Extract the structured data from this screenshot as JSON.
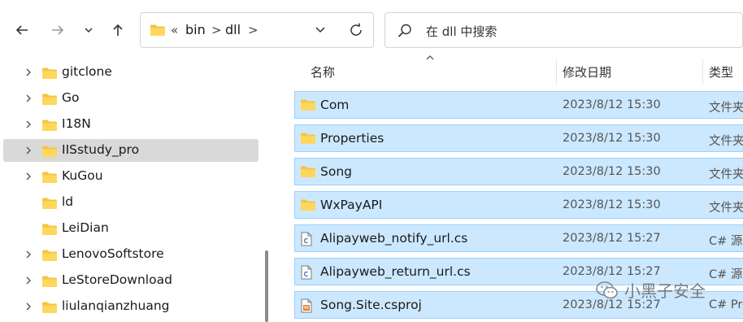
{
  "nav": {
    "back_icon": "arrow-left-icon",
    "forward_icon": "arrow-right-icon",
    "recent_icon": "chevron-down-icon",
    "up_icon": "arrow-up-icon"
  },
  "address": {
    "overflow": "«",
    "crumbs": [
      "bin",
      "dll"
    ],
    "separator": ">",
    "refresh_icon": "refresh-icon"
  },
  "search": {
    "placeholder": "在 dll 中搜索",
    "icon": "search-icon"
  },
  "sidebar": {
    "items": [
      {
        "label": "gitclone",
        "has_children": true,
        "selected": false
      },
      {
        "label": "Go",
        "has_children": true,
        "selected": false
      },
      {
        "label": "I18N",
        "has_children": true,
        "selected": false
      },
      {
        "label": "IISstudy_pro",
        "has_children": true,
        "selected": true
      },
      {
        "label": "KuGou",
        "has_children": true,
        "selected": false
      },
      {
        "label": "ld",
        "has_children": false,
        "selected": false
      },
      {
        "label": "LeiDian",
        "has_children": false,
        "selected": false
      },
      {
        "label": "LenovoSoftstore",
        "has_children": true,
        "selected": false
      },
      {
        "label": "LeStoreDownload",
        "has_children": true,
        "selected": false
      },
      {
        "label": "liulanqianzhuang",
        "has_children": true,
        "selected": false
      }
    ]
  },
  "columns": {
    "name": "名称",
    "modified": "修改日期",
    "type": "类型"
  },
  "files": [
    {
      "name": "Com",
      "date": "2023/8/12 15:30",
      "type": "文件夹",
      "icon": "folder-icon"
    },
    {
      "name": "Properties",
      "date": "2023/8/12 15:30",
      "type": "文件夹",
      "icon": "folder-icon"
    },
    {
      "name": "Song",
      "date": "2023/8/12 15:30",
      "type": "文件夹",
      "icon": "folder-icon"
    },
    {
      "name": "WxPayAPI",
      "date": "2023/8/12 15:30",
      "type": "文件夹",
      "icon": "folder-icon"
    },
    {
      "name": "Alipayweb_notify_url.cs",
      "date": "2023/8/12 15:27",
      "type": "C# 源文件",
      "icon": "cs-file-icon"
    },
    {
      "name": "Alipayweb_return_url.cs",
      "date": "2023/8/12 15:27",
      "type": "C# 源文件",
      "icon": "cs-file-icon"
    },
    {
      "name": "Song.Site.csproj",
      "date": "2023/8/12 15:27",
      "type": "C# Project",
      "icon": "csproj-file-icon"
    }
  ],
  "watermark": {
    "text": "小黑子安全",
    "icon": "wechat-icon"
  },
  "colors": {
    "selection_bg": "#cce8ff",
    "selection_border": "#99d1ff",
    "sidebar_selected": "#d9d9d9",
    "folder_yellow": "#f5c542"
  }
}
